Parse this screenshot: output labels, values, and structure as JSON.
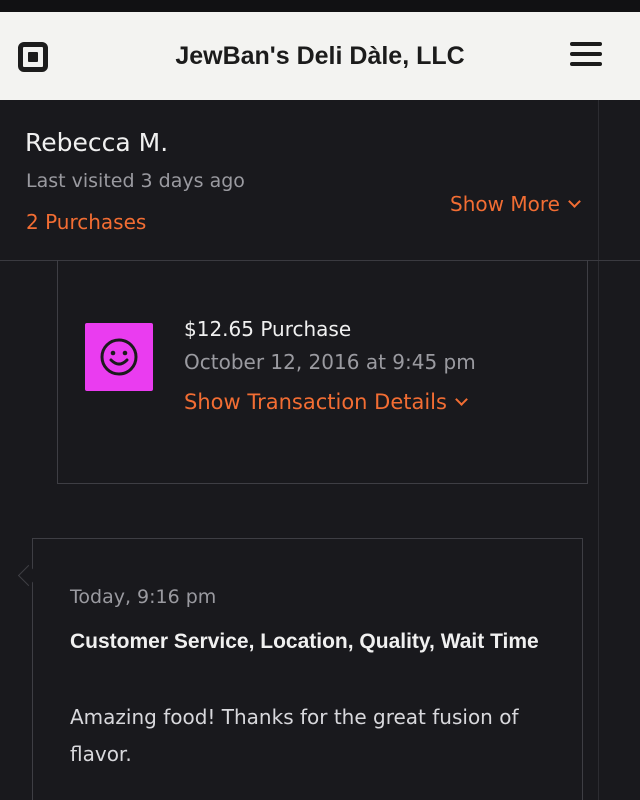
{
  "header": {
    "title": "JewBan's Deli Dàle, LLC",
    "logo_icon": "square-logo-icon",
    "menu_icon": "hamburger-menu-icon"
  },
  "customer": {
    "name": "Rebecca M.",
    "last_visited": "Last visited 3 days ago",
    "purchases_link": "2 Purchases",
    "show_more_label": "Show More"
  },
  "purchase": {
    "icon": "smiley-icon",
    "amount_label": "$12.65 Purchase",
    "date": "October 12, 2016 at 9:45 pm",
    "details_label": "Show Transaction Details"
  },
  "feedback": {
    "time": "Today, 9:16 pm",
    "tags": "Customer Service, Location, Quality, Wait Time",
    "comment": "Amazing food! Thanks for the great fusion of flavor."
  },
  "colors": {
    "accent": "#f26d33",
    "background": "#19191d",
    "header_bg": "#f3f3f1",
    "smiley_tile": "#ea3cf0"
  }
}
